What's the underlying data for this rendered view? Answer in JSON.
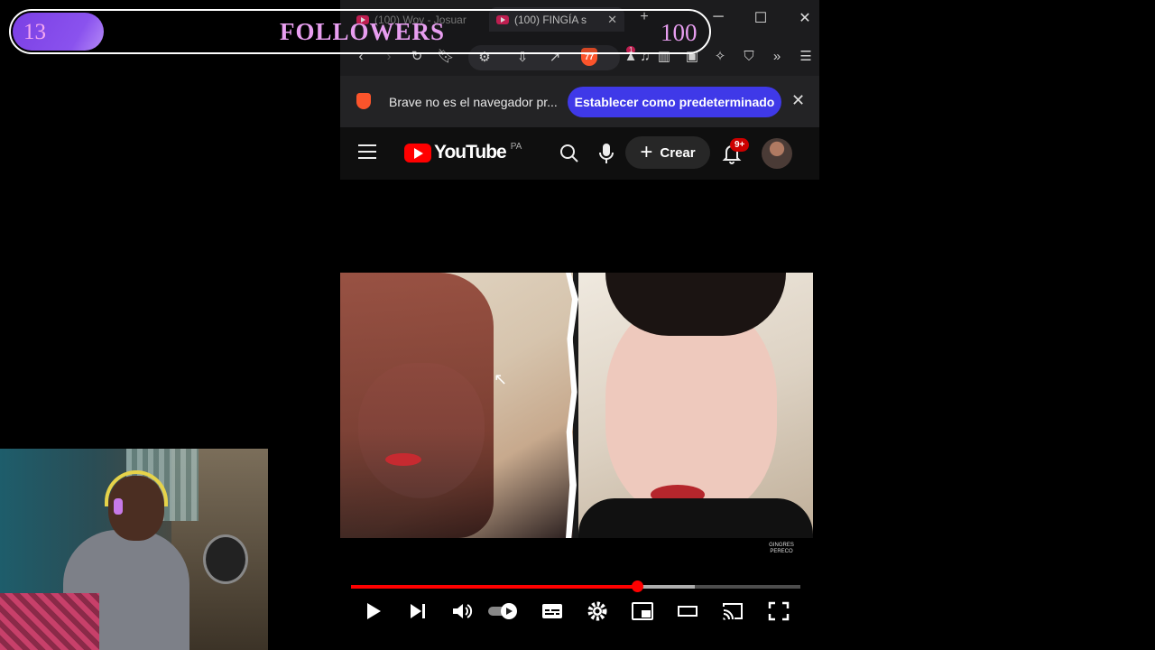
{
  "browser": {
    "tabs": [
      {
        "title": "(100) Woy - Josuar",
        "active": false
      },
      {
        "title": "(100) FINGÍA s",
        "active": true
      }
    ],
    "new_tab_label": "+",
    "shields_count": "77",
    "notification_count": "1"
  },
  "infobar": {
    "message": "Brave no es el navegador pr...",
    "button_label": "Establecer como predeterminado",
    "close_label": "✕"
  },
  "youtube": {
    "logo_text": "YouTube",
    "country_code": "PA",
    "create_label": "Crear",
    "notifications_badge": "9+"
  },
  "player": {
    "played_fraction": 0.636,
    "buffered_fraction": 0.765,
    "watermark": "GINGRES PERECO",
    "autoplay_on": true
  },
  "overlay": {
    "current": "13",
    "label": "FOLLOWERS",
    "goal": "100",
    "progress_fraction": 0.13
  },
  "colors": {
    "youtube_red": "#ff0000",
    "brave_blue_button": "#3f39e8",
    "overlay_purple": "#8a52ee",
    "overlay_text": "#e89ef0"
  }
}
